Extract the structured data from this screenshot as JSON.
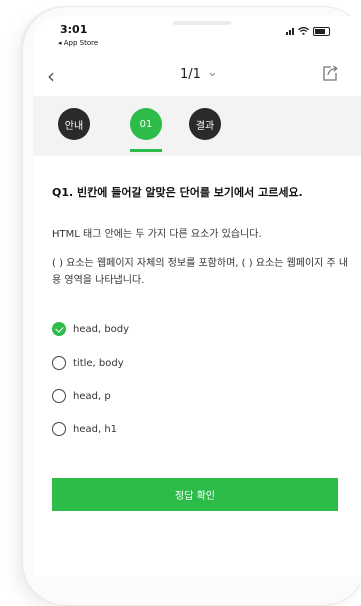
{
  "status_bar": {
    "time": "3:01",
    "back_app": "◂ App Store"
  },
  "nav": {
    "page_indicator": "1/1"
  },
  "tabs": [
    {
      "label": "안내"
    },
    {
      "label": "01"
    },
    {
      "label": "결과"
    }
  ],
  "quiz": {
    "question": "Q1. 빈칸에 들어갈 알맞은 단어를 보기에서 고르세요.",
    "passage_line1": "HTML 태그 안에는 두 가지 다른 요소가 있습니다.",
    "passage_line2": "(     ) 요소는 웹페이지 자체의 정보를 포함하며, (     ) 요소는 웹페이지 주 내용 영역을 나타냅니다.",
    "options": [
      {
        "label": "head, body",
        "selected": true
      },
      {
        "label": "title, body",
        "selected": false
      },
      {
        "label": "head, p",
        "selected": false
      },
      {
        "label": "head, h1",
        "selected": false
      }
    ],
    "submit_label": "정답 확인"
  },
  "colors": {
    "accent": "#2dbb4a",
    "tab_dark": "#2a2a2a",
    "tab_bar_bg": "#f3f3f3"
  }
}
